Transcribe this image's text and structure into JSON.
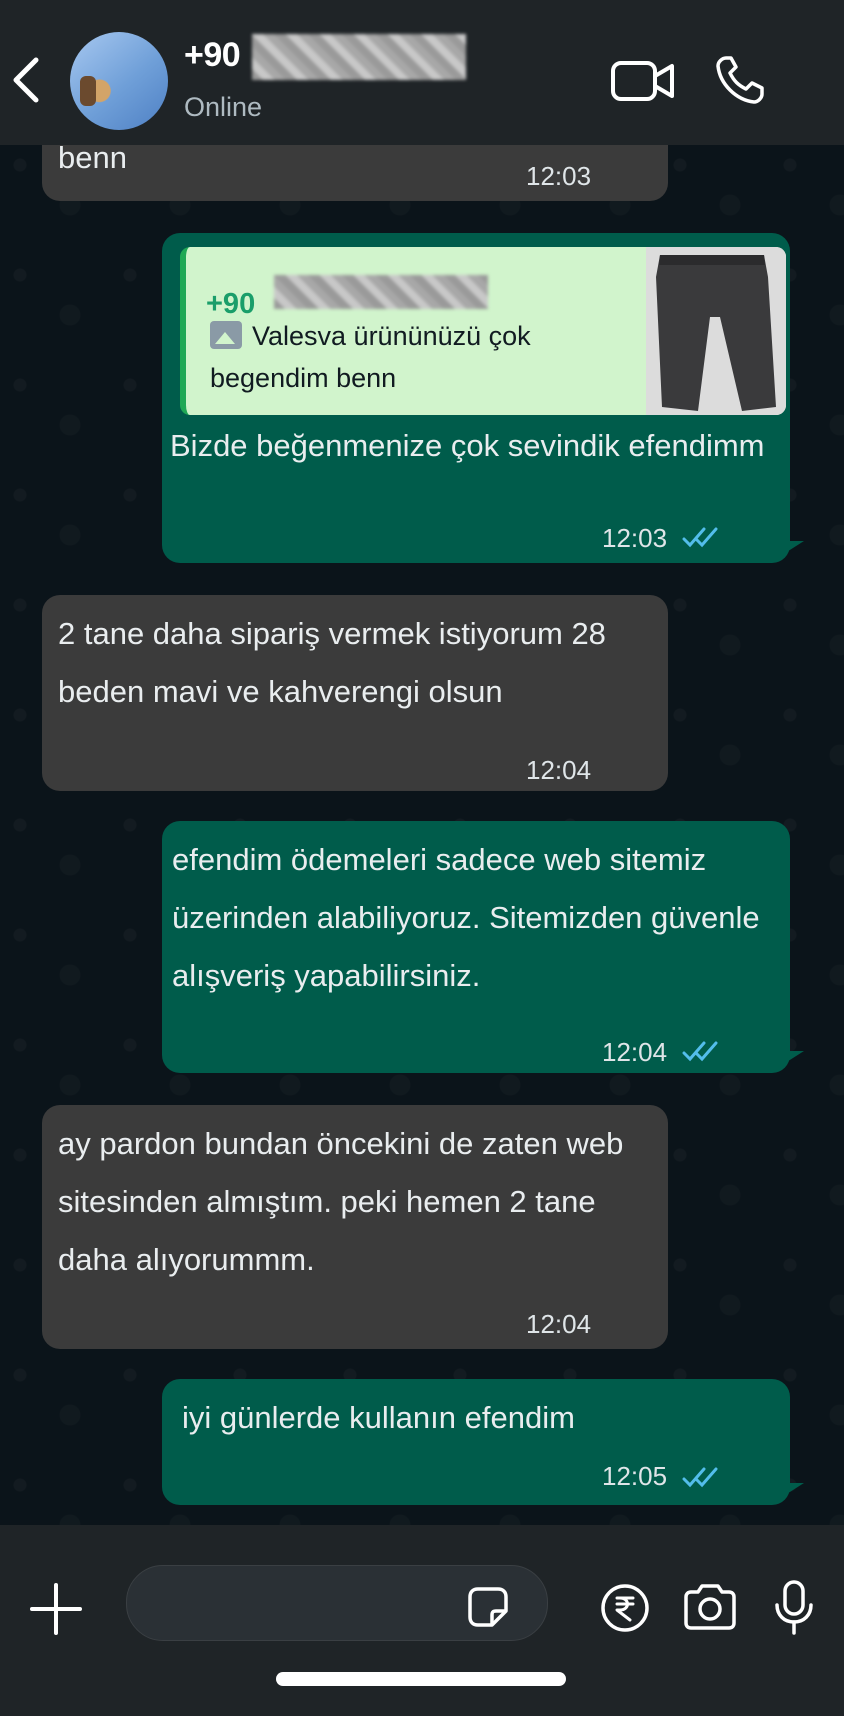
{
  "header": {
    "contact_name": "+90",
    "status": "Online"
  },
  "messages": [
    {
      "direction": "in",
      "text": "benn",
      "time": "12:03"
    },
    {
      "direction": "out",
      "quote": {
        "name": "+90",
        "text": "Valesva ürününüzü çok begendim benn"
      },
      "text": "Bizde beğenmenize çok sevindik efendimm",
      "time": "12:03"
    },
    {
      "direction": "in",
      "text": "2 tane daha sipariş vermek istiyorum 28 beden mavi ve kahverengi olsun",
      "time": "12:04"
    },
    {
      "direction": "out",
      "text": "efendim ödemeleri sadece web sitemiz üzerinden alabiliyoruz. Sitemizden güvenle alışveriş yapabilirsiniz.",
      "time": "12:04"
    },
    {
      "direction": "in",
      "text": "ay pardon bundan öncekini de zaten web sitesinden almıştım. peki hemen 2 tane daha alıyorummm.",
      "time": "12:04"
    },
    {
      "direction": "out",
      "text": "iyi günlerde kullanın efendim",
      "time": "12:05"
    }
  ],
  "colors": {
    "header_bg": "#1f2427",
    "chat_bg": "#0b141a",
    "incoming_bubble": "#3b3b3b",
    "outgoing_bubble": "#005c4b",
    "read_ticks": "#53bdeb",
    "quote_bg": "#d1f4cc",
    "quote_name": "#1a9e6a"
  },
  "icons": [
    "back-arrow-icon",
    "video-call-icon",
    "phone-icon",
    "plus-icon",
    "sticker-icon",
    "rupee-payment-icon",
    "camera-icon",
    "microphone-icon",
    "double-check-icon",
    "image-icon"
  ]
}
